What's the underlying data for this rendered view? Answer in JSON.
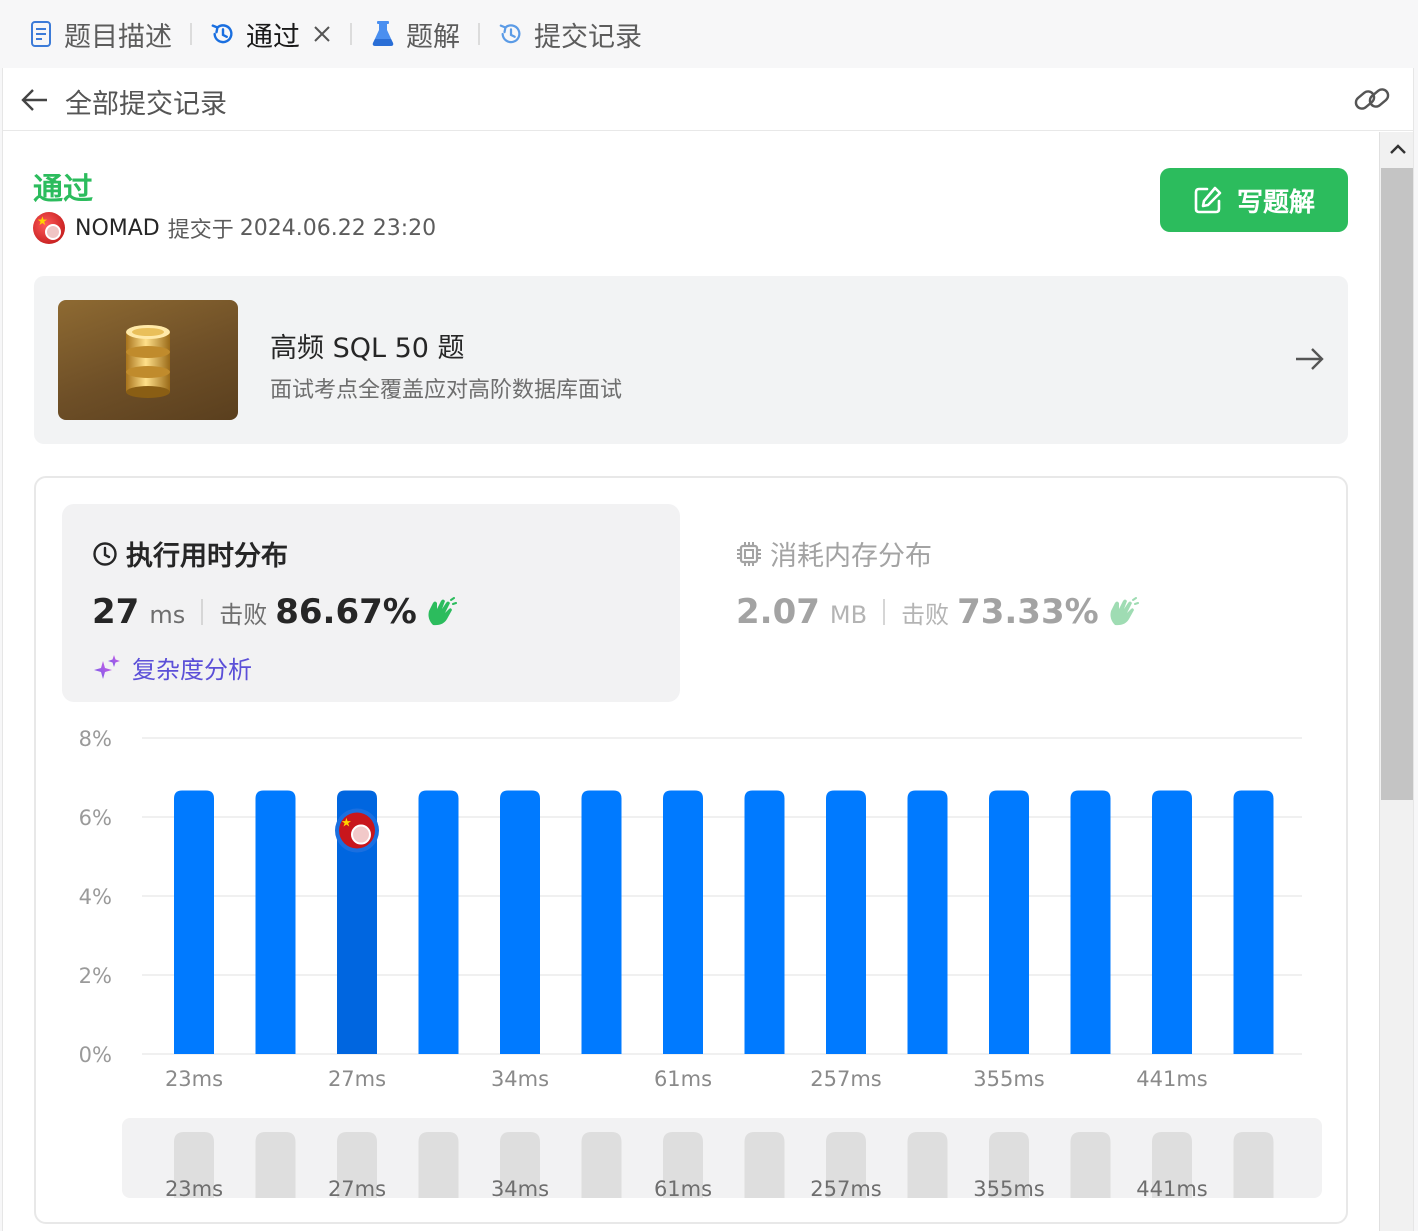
{
  "tabs": [
    {
      "label": "题目描述",
      "icon": "doc-icon",
      "active": false
    },
    {
      "label": "通过",
      "icon": "history-icon",
      "active": true,
      "closable": true
    },
    {
      "label": "题解",
      "icon": "flask-icon",
      "active": false
    },
    {
      "label": "提交记录",
      "icon": "history-icon",
      "active": false
    }
  ],
  "subheader": {
    "title": "全部提交记录"
  },
  "submission": {
    "status": "通过",
    "user": "NOMAD",
    "submitted_text": "提交于",
    "time": "2024.06.22 23:20"
  },
  "write_button": {
    "label": "写题解"
  },
  "study_plan": {
    "title": "高频 SQL 50 题",
    "subtitle": "面试考点全覆盖应对高阶数据库面试"
  },
  "runtime": {
    "title": "执行用时分布",
    "value": "27",
    "unit": "ms",
    "beats_label": "击败",
    "beats": "86.67%",
    "complexity_label": "复杂度分析"
  },
  "memory": {
    "title": "消耗内存分布",
    "value": "2.07",
    "unit": "MB",
    "beats_label": "击败",
    "beats": "73.33%"
  },
  "colors": {
    "accent_green": "#2cbc5d",
    "bar_blue": "#007aff",
    "bar_selected": "#0066e0"
  },
  "chart_data": {
    "type": "bar",
    "y_ticks": [
      "0%",
      "2%",
      "4%",
      "6%",
      "8%"
    ],
    "ylim": [
      0,
      8
    ],
    "values": [
      6.67,
      6.67,
      6.67,
      6.67,
      6.67,
      6.67,
      6.67,
      6.67,
      6.67,
      6.67,
      6.67,
      6.67,
      6.67,
      6.67
    ],
    "selected_index": 2,
    "x_labels": [
      {
        "index": 0,
        "label": "23ms"
      },
      {
        "index": 2,
        "label": "27ms"
      },
      {
        "index": 4,
        "label": "34ms"
      },
      {
        "index": 6,
        "label": "61ms"
      },
      {
        "index": 8,
        "label": "257ms"
      },
      {
        "index": 10,
        "label": "355ms"
      },
      {
        "index": 12,
        "label": "441ms"
      }
    ],
    "grid": true,
    "unit": "%"
  }
}
